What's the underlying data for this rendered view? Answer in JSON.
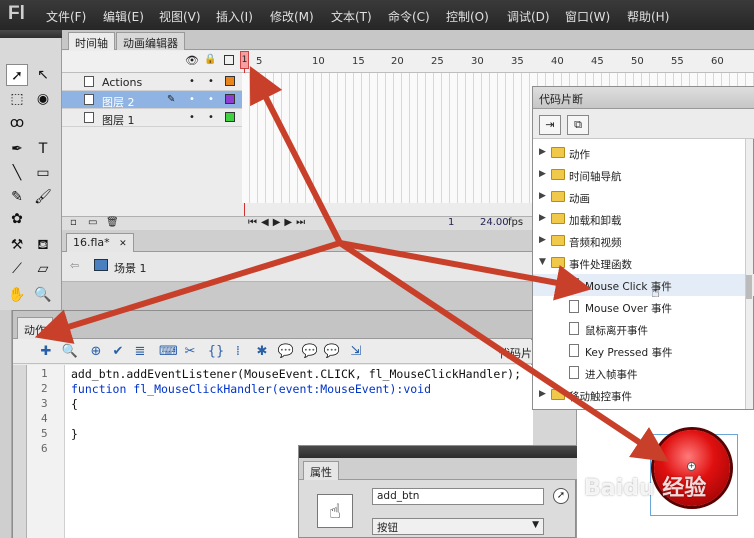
{
  "menubar": {
    "logo": "Fl",
    "items": [
      "文件(F)",
      "编辑(E)",
      "视图(V)",
      "插入(I)",
      "修改(M)",
      "文本(T)",
      "命令(C)",
      "控制(O)",
      "调试(D)",
      "窗口(W)",
      "帮助(H)"
    ]
  },
  "timeline": {
    "tabs": [
      "时间轴",
      "动画编辑器"
    ],
    "ruler": [
      "1",
      "5",
      "10",
      "15",
      "20",
      "25",
      "30",
      "35",
      "40",
      "45",
      "50",
      "55",
      "60"
    ],
    "playhead_frame": "1",
    "layers": [
      {
        "name": "Actions",
        "color": "#e8861a"
      },
      {
        "name": "图层 2",
        "color": "#8e3fd1"
      },
      {
        "name": "图层 1",
        "color": "#3fd13f"
      }
    ],
    "footer_frame": "1",
    "footer_fps": "24.00",
    "footer_fps_unit": "fps"
  },
  "document": {
    "tab": "16.fla*",
    "close_glyph": "✕",
    "scene": "场景 1"
  },
  "actions": {
    "tab": "动作",
    "toolbar_right": "代码片",
    "line_numbers": [
      "1",
      "2",
      "3",
      "4",
      "5",
      "6"
    ],
    "code": [
      "add_btn.addEventListener(MouseEvent.CLICK, fl_MouseClickHandler);",
      "function fl_MouseClickHandler(event:MouseEvent):void",
      "{",
      "",
      "}",
      ""
    ]
  },
  "snippets": {
    "title": "代码片断",
    "items": [
      {
        "type": "folder",
        "label": "动作"
      },
      {
        "type": "folder",
        "label": "时间轴导航"
      },
      {
        "type": "folder",
        "label": "动画"
      },
      {
        "type": "folder",
        "label": "加载和卸载"
      },
      {
        "type": "folder",
        "label": "音频和视频"
      },
      {
        "type": "folder-open",
        "label": "事件处理函数"
      },
      {
        "type": "snippet",
        "label": "Mouse Click 事件"
      },
      {
        "type": "snippet",
        "label": "Mouse Over 事件"
      },
      {
        "type": "snippet",
        "label": "鼠标离开事件"
      },
      {
        "type": "snippet",
        "label": "Key Pressed 事件"
      },
      {
        "type": "snippet",
        "label": "进入帧事件"
      },
      {
        "type": "folder",
        "label": "移动触控事件"
      }
    ]
  },
  "properties": {
    "tab": "属性",
    "instance_name": "add_btn",
    "symbol_type": "按钮"
  },
  "watermark": "Baidu 经验",
  "colors": {
    "arrow": "#c9402a",
    "selected_layer": "#8fb4e3"
  }
}
